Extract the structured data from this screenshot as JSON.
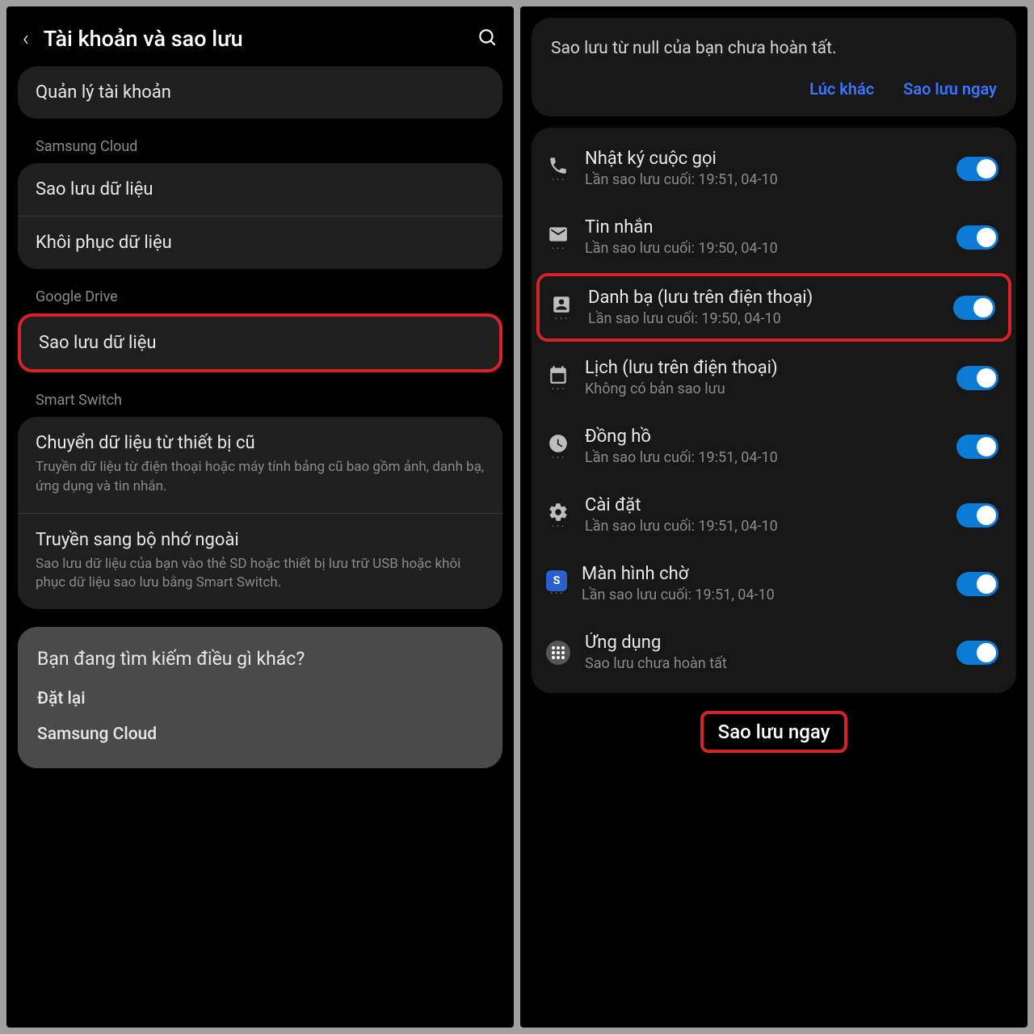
{
  "left": {
    "title": "Tài khoản và sao lưu",
    "manage_accounts": "Quản lý tài khoản",
    "section_samsung_cloud": "Samsung Cloud",
    "backup_data": "Sao lưu dữ liệu",
    "restore_data": "Khôi phục dữ liệu",
    "section_google_drive": "Google Drive",
    "gd_backup_data": "Sao lưu dữ liệu",
    "section_smart_switch": "Smart Switch",
    "transfer_old": {
      "title": "Chuyển dữ liệu từ thiết bị cũ",
      "sub": "Truyền dữ liệu từ điện thoại hoặc máy tính bảng cũ bao gồm ảnh, danh bạ, ứng dụng và tin nhắn."
    },
    "transfer_ext": {
      "title": "Truyền sang bộ nhớ ngoài",
      "sub": "Sao lưu dữ liệu của bạn vào thẻ SD hoặc thiết bị lưu trữ USB hoặc khôi phục dữ liệu sao lưu bằng Smart Switch."
    },
    "looking": {
      "title": "Bạn đang tìm kiếm điều gì khác?",
      "reset": "Đặt lại",
      "samsung_cloud": "Samsung Cloud"
    }
  },
  "right": {
    "banner_text": "Sao lưu từ null của bạn chưa hoàn tất.",
    "banner_later": "Lúc khác",
    "banner_now": "Sao lưu ngay",
    "items": [
      {
        "title": "Nhật ký cuộc gọi",
        "sub": "Lần sao lưu cuối: 19:51, 04-10"
      },
      {
        "title": "Tin nhắn",
        "sub": "Lần sao lưu cuối: 19:50, 04-10"
      },
      {
        "title": "Danh bạ (lưu trên điện thoại)",
        "sub": "Lần sao lưu cuối: 19:50, 04-10"
      },
      {
        "title": "Lịch (lưu trên điện thoại)",
        "sub": "Không có bản sao lưu"
      },
      {
        "title": "Đồng hồ",
        "sub": "Lần sao lưu cuối: 19:51, 04-10"
      },
      {
        "title": "Cài đặt",
        "sub": "Lần sao lưu cuối: 19:51, 04-10"
      },
      {
        "title": "Màn hình chờ",
        "sub": "Lần sao lưu cuối: 19:51, 04-10"
      },
      {
        "title": "Ứng dụng",
        "sub": "Sao lưu chưa hoàn tất"
      }
    ],
    "backup_now": "Sao lưu ngay"
  }
}
